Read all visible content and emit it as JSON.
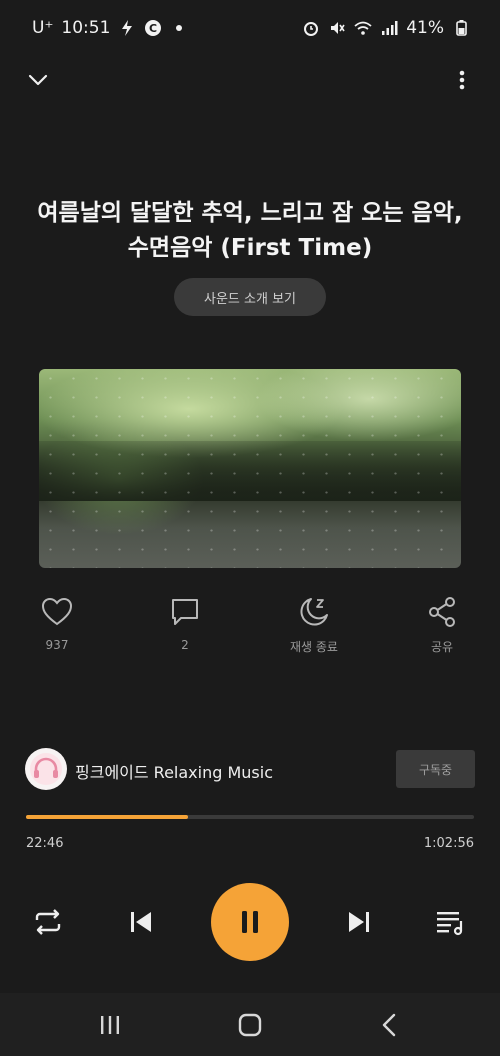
{
  "status_bar": {
    "carrier": "U⁺",
    "time": "10:51",
    "battery": "41%",
    "icons": [
      "lightning-icon",
      "c-badge-icon",
      "dot-icon",
      "alarm-icon",
      "mute-icon",
      "wifi-icon",
      "signal-icon",
      "battery-icon"
    ]
  },
  "header": {
    "collapse_icon": "chevron-down-icon",
    "more_icon": "more-vertical-icon"
  },
  "track": {
    "title": "여름날의 달달한 추억, 느리고 잠 오는 음악, 수면음악 (First Time)",
    "intro_button_label": "사운드 소개 보기"
  },
  "actions": [
    {
      "icon": "heart-icon",
      "label": "937"
    },
    {
      "icon": "comment-icon",
      "label": "2"
    },
    {
      "icon": "sleep-timer-icon",
      "label": "재생 종료"
    },
    {
      "icon": "share-icon",
      "label": "공유"
    }
  ],
  "channel": {
    "name": "핑크에이드 Relaxing Music",
    "subscribe_label": "구독중"
  },
  "player": {
    "current_time": "22:46",
    "total_time": "1:02:56",
    "progress": 0.362
  },
  "controls": {
    "repeat_icon": "repeat-icon",
    "prev_icon": "previous-icon",
    "pause_icon": "pause-icon",
    "next_icon": "next-icon",
    "playlist_icon": "playlist-icon"
  },
  "nav": {
    "recents_icon": "recents-icon",
    "home_icon": "home-icon",
    "back_icon": "back-icon"
  },
  "colors": {
    "accent": "#f5a337",
    "background": "#1b1b1b",
    "button_bg": "#3a3a3a"
  }
}
